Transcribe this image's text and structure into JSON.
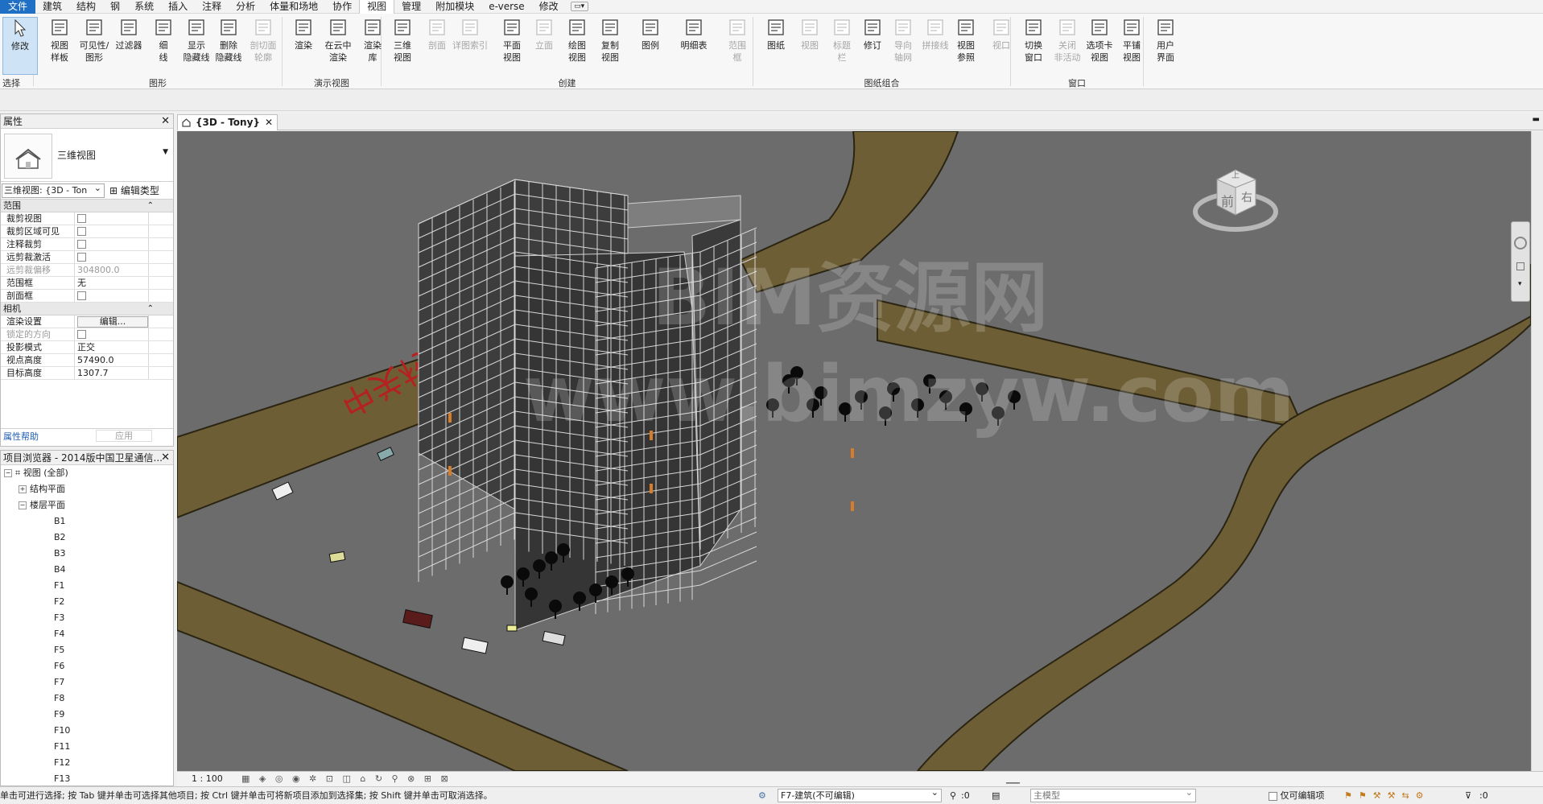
{
  "menu": [
    "文件",
    "建筑",
    "结构",
    "钢",
    "系统",
    "插入",
    "注释",
    "分析",
    "体量和场地",
    "协作",
    "视图",
    "管理",
    "附加模块",
    "e-verse",
    "修改"
  ],
  "menu_active": "视图",
  "ribbon": {
    "buttons": [
      {
        "label": "修改",
        "state": "selected"
      },
      {
        "label": "视图\n样板",
        "state": "normal"
      },
      {
        "label": "可见性/\n图形",
        "state": "normal"
      },
      {
        "label": "过滤器",
        "state": "normal"
      },
      {
        "label": "细\n线",
        "state": "normal"
      },
      {
        "label": "显示\n隐藏线",
        "state": "normal"
      },
      {
        "label": "删除\n隐藏线",
        "state": "normal"
      },
      {
        "label": "剖切面\n轮廓",
        "state": "disabled"
      },
      {
        "label": "渲染",
        "state": "normal"
      },
      {
        "label": "在云中\n渲染",
        "state": "normal"
      },
      {
        "label": "渲染\n库",
        "state": "normal"
      },
      {
        "label": "三维\n视图",
        "state": "normal"
      },
      {
        "label": "剖面",
        "state": "disabled"
      },
      {
        "label": "详图索引",
        "state": "disabled"
      },
      {
        "label": "平面\n视图",
        "state": "normal"
      },
      {
        "label": "立面",
        "state": "disabled"
      },
      {
        "label": "绘图\n视图",
        "state": "normal"
      },
      {
        "label": "复制\n视图",
        "state": "normal"
      },
      {
        "label": "图例",
        "state": "normal"
      },
      {
        "label": "明细表",
        "state": "normal"
      },
      {
        "label": "范围\n框",
        "state": "disabled"
      },
      {
        "label": "图纸",
        "state": "normal"
      },
      {
        "label": "视图",
        "state": "disabled"
      },
      {
        "label": "标题\n栏",
        "state": "disabled"
      },
      {
        "label": "修订",
        "state": "normal"
      },
      {
        "label": "导向\n轴网",
        "state": "disabled"
      },
      {
        "label": "拼接线",
        "state": "disabled"
      },
      {
        "label": "视图\n参照",
        "state": "normal"
      },
      {
        "label": "视口",
        "state": "disabled"
      },
      {
        "label": "切换\n窗口",
        "state": "normal"
      },
      {
        "label": "关闭\n非活动",
        "state": "disabled"
      },
      {
        "label": "选项卡\n视图",
        "state": "normal"
      },
      {
        "label": "平铺\n视图",
        "state": "normal"
      },
      {
        "label": "用户\n界面",
        "state": "normal"
      }
    ],
    "groups": [
      "选择",
      "图形",
      "演示视图",
      "创建",
      "图纸组合",
      "窗口"
    ]
  },
  "properties": {
    "title": "属性",
    "type_name": "三维视图",
    "view_selector": "三维视图: {3D - Ton",
    "edit_type": "编辑类型",
    "sections": [
      {
        "title": "范围",
        "rows": [
          {
            "key": "裁剪视图",
            "kind": "check",
            "value": ""
          },
          {
            "key": "裁剪区域可见",
            "kind": "check",
            "value": ""
          },
          {
            "key": "注释裁剪",
            "kind": "check",
            "value": ""
          },
          {
            "key": "远剪裁激活",
            "kind": "check",
            "value": ""
          },
          {
            "key": "远剪裁偏移",
            "kind": "text",
            "value": "304800.0",
            "dim": true
          },
          {
            "key": "范围框",
            "kind": "text",
            "value": "无"
          },
          {
            "key": "剖面框",
            "kind": "check",
            "value": ""
          }
        ]
      },
      {
        "title": "相机",
        "rows": [
          {
            "key": "渲染设置",
            "kind": "button",
            "value": "编辑..."
          },
          {
            "key": "锁定的方向",
            "kind": "check",
            "value": "",
            "dim": true
          },
          {
            "key": "投影模式",
            "kind": "text",
            "value": "正交"
          },
          {
            "key": "视点高度",
            "kind": "text",
            "value": "57490.0"
          },
          {
            "key": "目标高度",
            "kind": "text",
            "value": "1307.7"
          }
        ]
      }
    ],
    "help": "属性帮助",
    "apply": "应用"
  },
  "browser": {
    "title": "项目浏览器 - 2014版中国卫星通信...",
    "root": "视图 (全部)",
    "nodes": [
      "结构平面",
      "楼层平面"
    ],
    "floors": [
      "B1",
      "B2",
      "B3",
      "B4",
      "F1",
      "F2",
      "F3",
      "F4",
      "F5",
      "F6",
      "F7",
      "F8",
      "F9",
      "F10",
      "F11",
      "F12",
      "F13"
    ]
  },
  "tab": {
    "label": "{3D - Tony}"
  },
  "viewport": {
    "watermark_line1": "BIM资源网",
    "watermark_line2": "www.bimzyw.com",
    "road_text": "中关村南三街",
    "viewcube_left": "前",
    "viewcube_right": "右",
    "viewcube_top": "上"
  },
  "view_control": {
    "scale": "1 : 100"
  },
  "status": {
    "hint": "单击可进行选择; 按 Tab 键并单击可选择其他项目; 按 Ctrl 键并单击可将新项目添加到选择集; 按 Shift 键并单击可取消选择。",
    "view_select": "F7-建筑(不可编辑)",
    "count": ":0",
    "model": "主模型",
    "editable_only": "仅可编辑项",
    "filter_count": ":0"
  },
  "colors": {
    "accent": "#1f6fc5",
    "viewport_bg": "#6c6c6c",
    "road": "#6e5e36"
  }
}
